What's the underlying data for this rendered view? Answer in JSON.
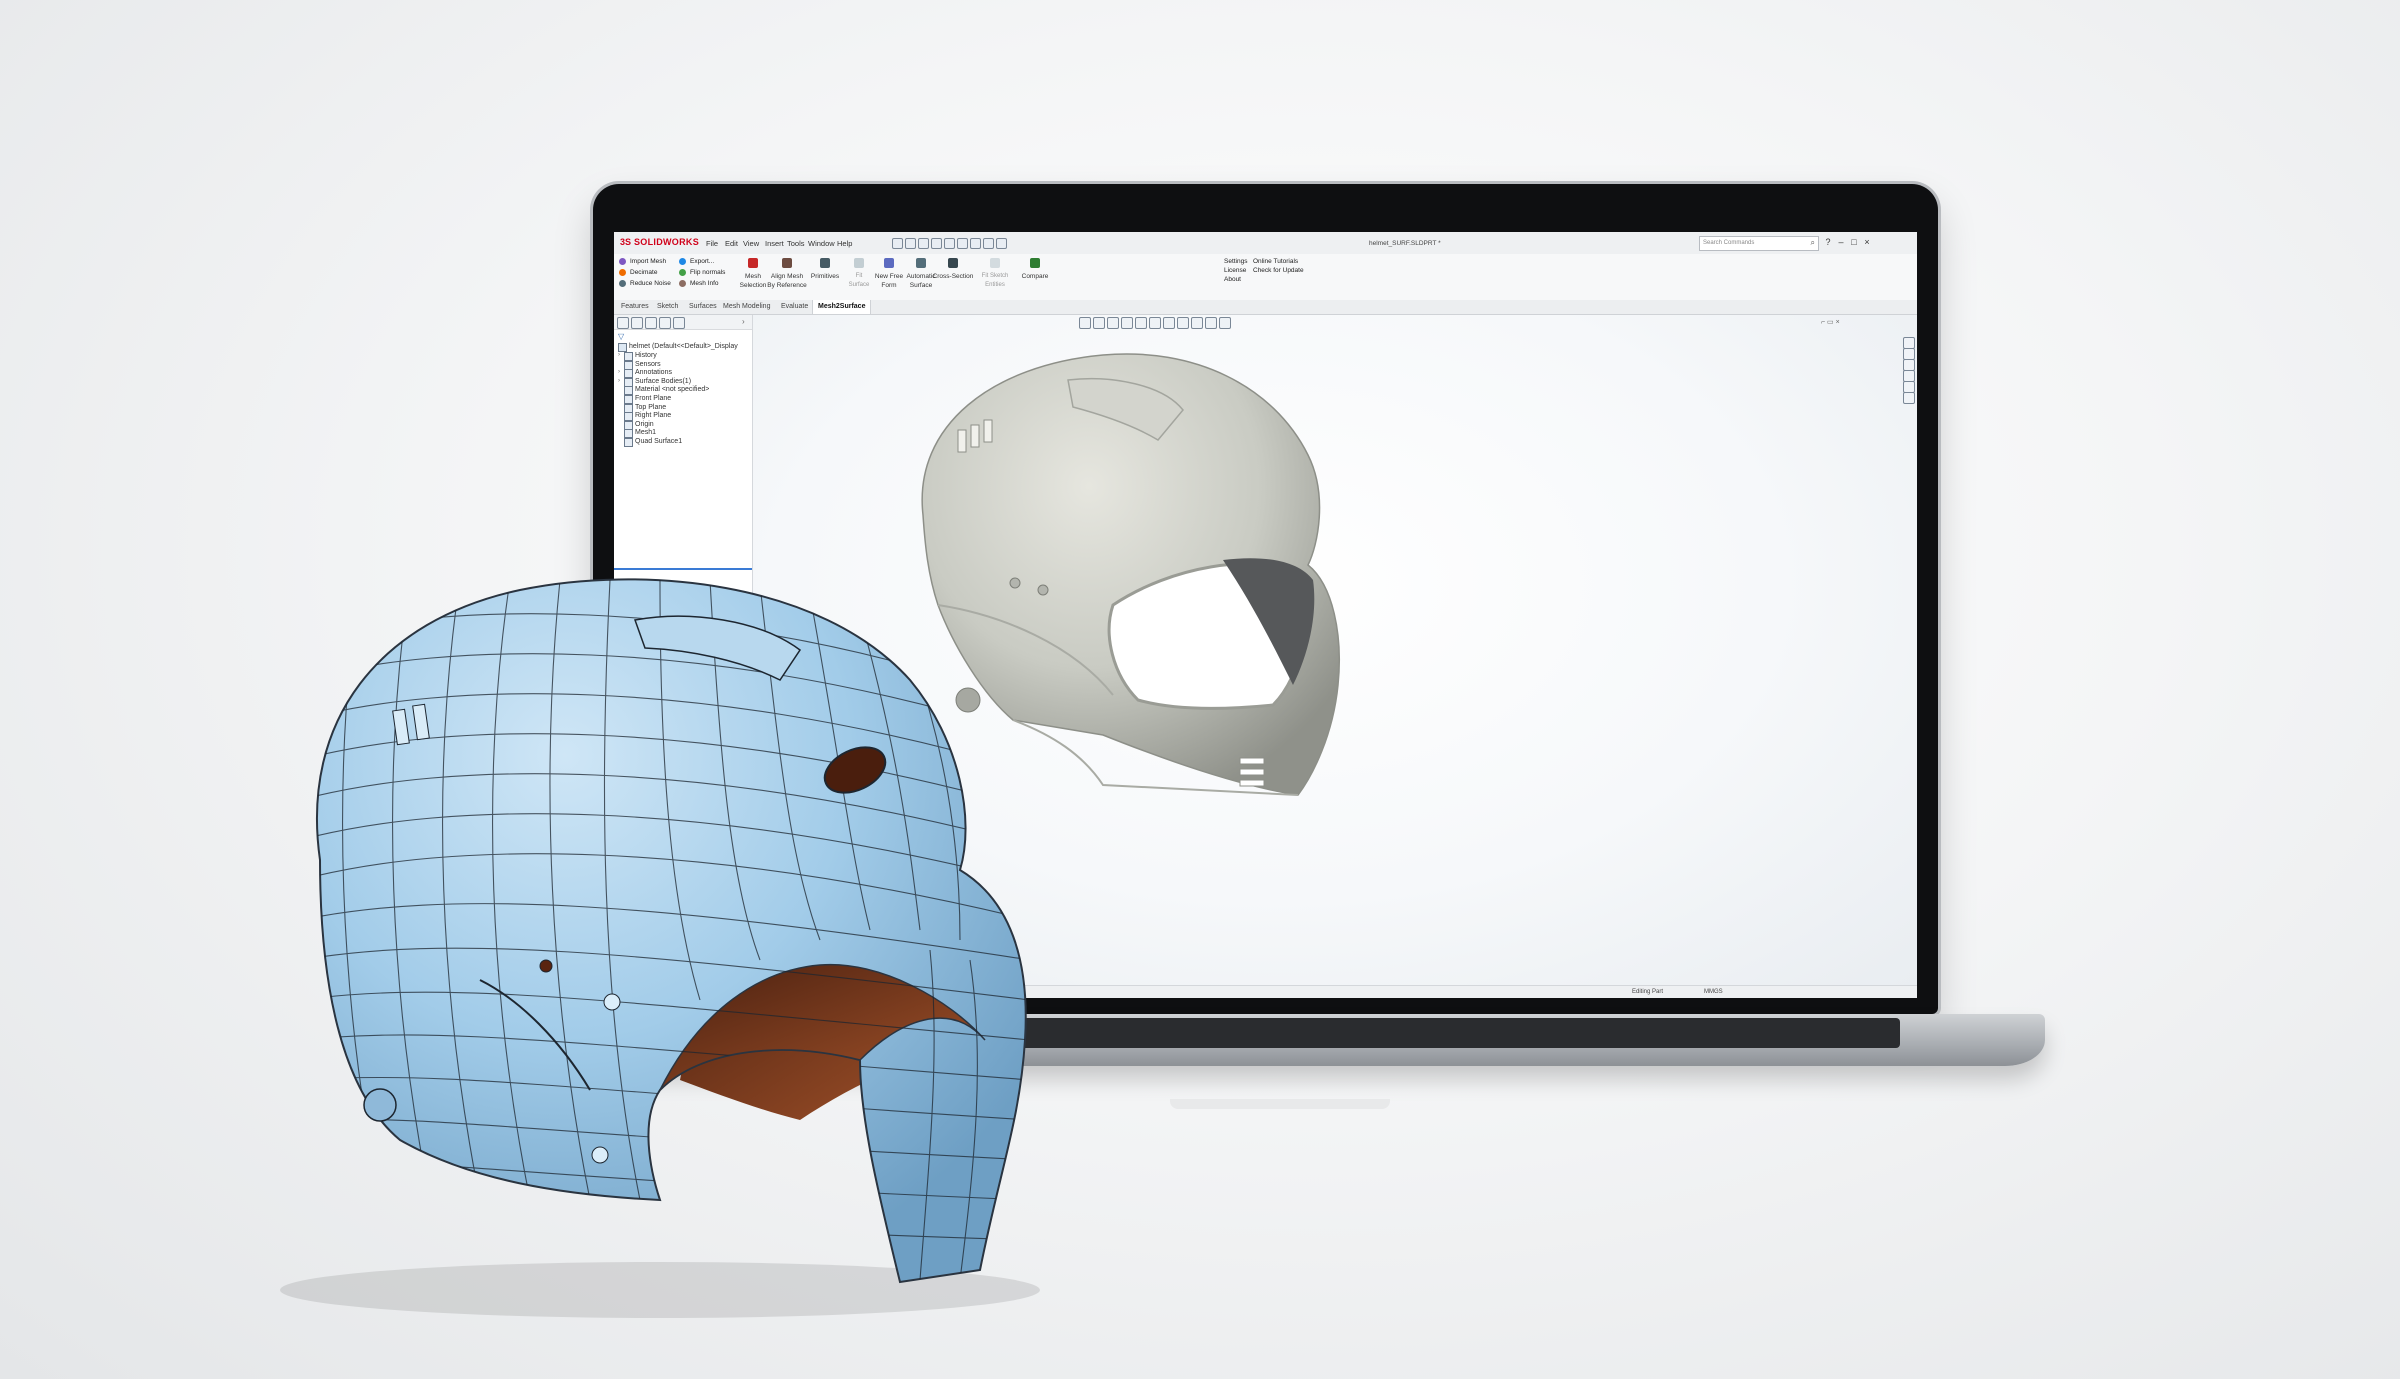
{
  "app": {
    "logo_prefix": "3S",
    "logo_name": "SOLIDWORKS",
    "document_title": "helmet_SURF.SLDPRT *",
    "search_placeholder": "Search Commands"
  },
  "menu": [
    "File",
    "Edit",
    "View",
    "Insert",
    "Tools",
    "Window",
    "Help"
  ],
  "ribbon": {
    "left_group": [
      {
        "label": "Import Mesh"
      },
      {
        "label": "Decimate"
      },
      {
        "label": "Reduce Noise"
      },
      {
        "label": "Export..."
      },
      {
        "label": "Flip normals"
      },
      {
        "label": "Mesh Info"
      }
    ],
    "commands": [
      {
        "line1": "Mesh",
        "line2": "Selection"
      },
      {
        "line1": "Align Mesh",
        "line2": "By Reference"
      },
      {
        "line1": "Primitives",
        "line2": ""
      },
      {
        "line1": "Fit",
        "line2": "Surface"
      },
      {
        "line1": "New Free",
        "line2": "Form"
      },
      {
        "line1": "Automatic",
        "line2": "Surface"
      },
      {
        "line1": "Cross-Section",
        "line2": ""
      },
      {
        "line1": "Fit Sketch",
        "line2": "Entities"
      },
      {
        "line1": "Compare",
        "line2": ""
      }
    ],
    "right_group": [
      {
        "label": "Settings"
      },
      {
        "label": "License"
      },
      {
        "label": "About"
      },
      {
        "label": "Online Tutorials"
      },
      {
        "label": "Check for Update"
      }
    ]
  },
  "tabs": [
    "Features",
    "Sketch",
    "Surfaces",
    "Mesh Modeling",
    "Evaluate",
    "Mesh2Surface"
  ],
  "active_tab": "Mesh2Surface",
  "tree": {
    "root": "helmet  (Default<<Default>_Display",
    "items": [
      "History",
      "Sensors",
      "Annotations",
      "Surface Bodies(1)",
      "Material <not specified>",
      "Front Plane",
      "Top Plane",
      "Right Plane",
      "Origin",
      "Mesh1",
      "Quad Surface1"
    ]
  },
  "status": {
    "mode": "Editing Part",
    "units": "MMGS"
  },
  "colors": {
    "accent": "#d0021b",
    "mesh_model": "#c9cbc3",
    "surface_model": "#9cc7e6",
    "surface_interior": "#7a3b1d"
  }
}
